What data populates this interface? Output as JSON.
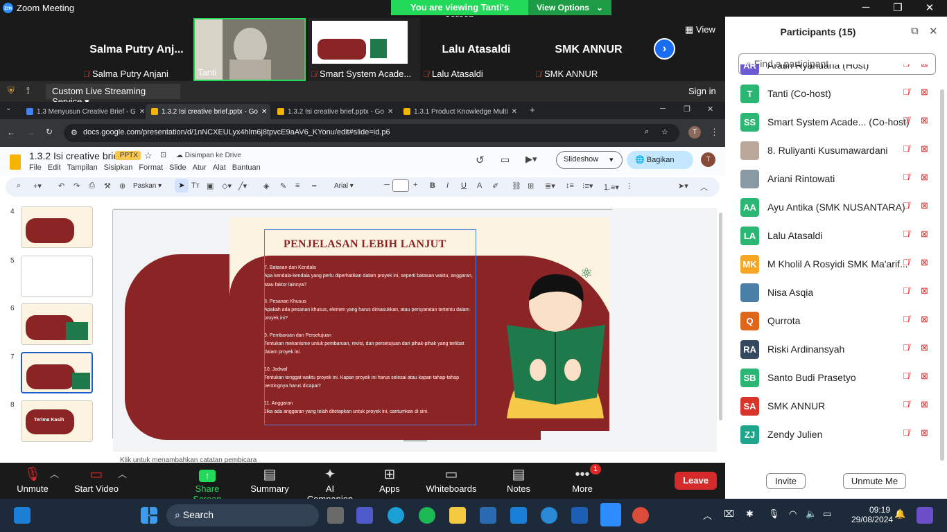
{
  "window": {
    "title": "Zoom Meeting"
  },
  "banner": {
    "text": "You are viewing Tanti's screen",
    "options": "View Options"
  },
  "gallery": {
    "tiles": [
      {
        "name": "Salma  Putry  Anj...",
        "label": "Salma Putry Anjani"
      },
      {
        "name": "",
        "label": "Tanti"
      },
      {
        "name": "",
        "label": "Smart System Acade..."
      },
      {
        "name": "Lalu Atasaldi",
        "label": "Lalu Atasaldi"
      },
      {
        "name": "SMK ANNUR",
        "label": "SMK ANNUR"
      }
    ],
    "view_label": "View"
  },
  "shared": {
    "stream_label": "Custom Live Streaming Service",
    "signin": "Sign in",
    "tabs": [
      "1.3 Menyusun Creative Brief - G",
      "1.3.2 Isi creative brief.pptx - Go",
      "1.3.2 Isi creative brief.pptx - Go",
      "1.3.1 Product Knowledge Multi"
    ],
    "url": "docs.google.com/presentation/d/1nNCXEULyx4hlm6j8tpvcE9aAV6_KYonu/edit#slide=id.p6",
    "doc_title": "1.3.2 Isi creative brief",
    "doc_badge": ".PPTX",
    "saved": "Disimpan ke Drive",
    "menus": [
      "File",
      "Edit",
      "Tampilan",
      "Sisipkan",
      "Format",
      "Slide",
      "Atur",
      "Alat",
      "Bantuan"
    ],
    "slideshow": "Slideshow",
    "share": "Bagikan",
    "avatar": "T",
    "zoom": "Paskan",
    "font": "Arial",
    "slide_numbers": [
      "4",
      "5",
      "6",
      "7",
      "8"
    ],
    "thumb8": "Terima Kasih",
    "notes_placeholder": "Klik untuk menambahkan catatan pembicara",
    "slide": {
      "heading": "PENJELASAN LEBIH LANJUT",
      "items": [
        {
          "title": "7. Batasan dan Kendala",
          "body": "Apa kendala-kendala yang perlu diperhatikan dalam proyek ini, seperti batasan waktu, anggaran, atau faktor lainnya?"
        },
        {
          "title": "8. Pesanan Khusus",
          "body": "Apakah ada pesanan khusus, elemen yang harus dimasukkan, atau persyaratan tertentu dalam proyek ini?"
        },
        {
          "title": "9. Pembaruan dan Persetujuan",
          "body": "Tentukan mekanisme untuk pembaruan, revisi, dan persetujuan dari pihak-pihak yang terlibat dalam proyek ini."
        },
        {
          "title": "10. Jadwal",
          "body": "Tentukan tenggat waktu proyek ini. Kapan proyek ini harus selesai atau kapan tahap-tahap pentingnya harus dicapai?"
        },
        {
          "title": "11. Anggaran",
          "body": "Jika ada anggaran yang telah ditetapkan untuk proyek ini, cantumkan di sini."
        }
      ]
    }
  },
  "controls": [
    {
      "label": "Unmute",
      "icon": "mic-off-icon"
    },
    {
      "label": "Start Video",
      "icon": "video-off-icon"
    },
    {
      "label": "Share Screen",
      "icon": "share-screen-icon"
    },
    {
      "label": "Summary",
      "icon": "summary-icon"
    },
    {
      "label": "AI Companion",
      "icon": "ai-companion-icon"
    },
    {
      "label": "Apps",
      "icon": "apps-icon"
    },
    {
      "label": "Whiteboards",
      "icon": "whiteboard-icon"
    },
    {
      "label": "Notes",
      "icon": "notes-icon"
    },
    {
      "label": "More",
      "icon": "more-icon"
    }
  ],
  "more_badge": "1",
  "leave": "Leave",
  "participants": {
    "title": "Participants (15)",
    "search_placeholder": "Find a participant",
    "list": [
      {
        "initials": "AR",
        "name": "Arafin Ryandana (Host)",
        "color": "#6b5bd2"
      },
      {
        "initials": "T",
        "name": "Tanti (Co-host)",
        "color": "#2bb673"
      },
      {
        "initials": "SS",
        "name": "Smart System Acade...  (Co-host)",
        "color": "#2bb673"
      },
      {
        "initials": "",
        "name": "8. Ruliyanti Kusumawardani",
        "color": "#b9a89a"
      },
      {
        "initials": "",
        "name": "Ariani Rintowati",
        "color": "#8a9aa5"
      },
      {
        "initials": "AA",
        "name": "Ayu Antika (SMK NUSANTARA)",
        "color": "#2bb673"
      },
      {
        "initials": "LA",
        "name": "Lalu Atasaldi",
        "color": "#2bb673"
      },
      {
        "initials": "MK",
        "name": "M Kholil A Rosyidi SMK Ma'arif...",
        "color": "#f5a623"
      },
      {
        "initials": "",
        "name": "Nisa Asqia",
        "color": "#4a7fa8"
      },
      {
        "initials": "Q",
        "name": "Qurrota",
        "color": "#e0671a"
      },
      {
        "initials": "RA",
        "name": "Riski Ardinansyah",
        "color": "#34495e"
      },
      {
        "initials": "SB",
        "name": "Santo Budi Prasetyo",
        "color": "#2bb673"
      },
      {
        "initials": "SA",
        "name": "SMK ANNUR",
        "color": "#d9342b"
      },
      {
        "initials": "ZJ",
        "name": "Zendy Julien",
        "color": "#1fa58b"
      }
    ],
    "invite": "Invite",
    "unmute_me": "Unmute Me"
  },
  "taskbar": {
    "search": "Search",
    "time": "09:19",
    "date": "29/08/2024"
  }
}
